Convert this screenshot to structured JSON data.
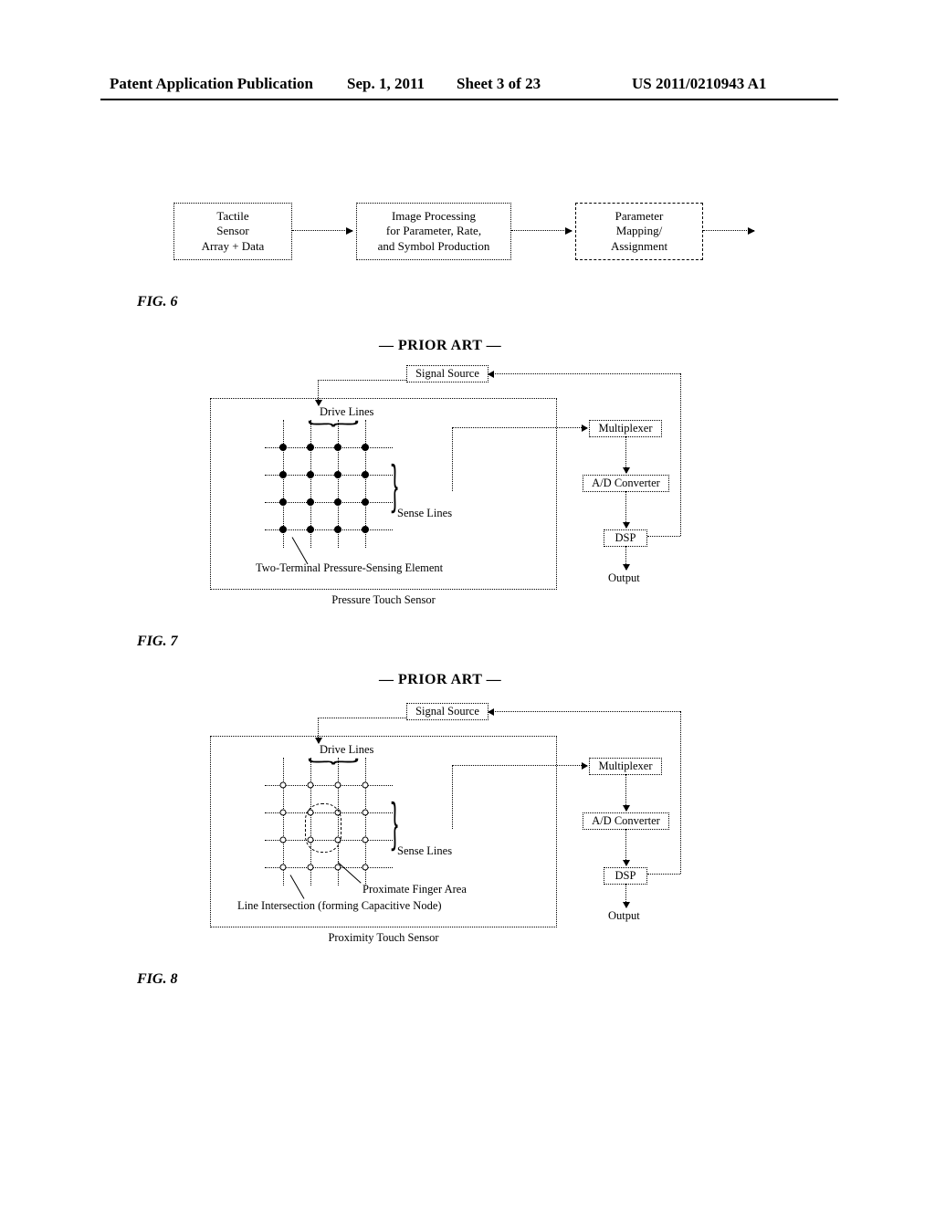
{
  "header": {
    "left": "Patent Application Publication",
    "date": "Sep. 1, 2011",
    "sheet": "Sheet 3 of 23",
    "pubno": "US 2011/0210943 A1"
  },
  "fig6": {
    "label": "FIG. 6",
    "box1": "Tactile\nSensor\nArray + Data",
    "box2": "Image Processing\nfor Parameter, Rate,\nand Symbol Production",
    "box3": "Parameter\nMapping/\nAssignment"
  },
  "priorArt": "— PRIOR ART —",
  "sensorBlocks": {
    "signal": "Signal Source",
    "mux": "Multiplexer",
    "adc": "A/D Converter",
    "dsp": "DSP",
    "output": "Output",
    "drive": "Drive Lines",
    "sense": "Sense Lines"
  },
  "fig7": {
    "label": "FIG. 7",
    "caption": "Pressure Touch Sensor",
    "element": "Two-Terminal Pressure-Sensing Element"
  },
  "fig8": {
    "label": "FIG. 8",
    "caption": "Proximity Touch Sensor",
    "finger": "Proximate Finger Area",
    "element": "Line Intersection (forming Capacitive Node)"
  },
  "chart_data": [
    {
      "type": "table",
      "title": "FIG. 6 — processing pipeline (block diagram)",
      "nodes": [
        "Tactile Sensor Array + Data",
        "Image Processing for Parameter, Rate, and Symbol Production",
        "Parameter Mapping/Assignment",
        "(out)"
      ],
      "edges": [
        [
          0,
          1
        ],
        [
          1,
          2
        ],
        [
          2,
          3
        ]
      ]
    },
    {
      "type": "table",
      "title": "FIG. 7 — Pressure Touch Sensor (PRIOR ART)",
      "nodes": [
        "Signal Source",
        "Drive Lines",
        "Sense Lines",
        "Two-Terminal Pressure-Sensing Element",
        "Multiplexer",
        "A/D Converter",
        "DSP",
        "Output"
      ],
      "edges": [
        [
          0,
          1
        ],
        [
          2,
          4
        ],
        [
          4,
          5
        ],
        [
          5,
          6
        ],
        [
          6,
          7
        ],
        [
          6,
          0
        ]
      ],
      "grid": {
        "drive_lines": 4,
        "sense_lines": 4,
        "node_type": "pressure-sensing element (filled dot)"
      }
    },
    {
      "type": "table",
      "title": "FIG. 8 — Proximity Touch Sensor (PRIOR ART)",
      "nodes": [
        "Signal Source",
        "Drive Lines",
        "Sense Lines",
        "Line Intersection (forming Capacitive Node)",
        "Proximate Finger Area",
        "Multiplexer",
        "A/D Converter",
        "DSP",
        "Output"
      ],
      "edges": [
        [
          0,
          1
        ],
        [
          2,
          5
        ],
        [
          5,
          6
        ],
        [
          6,
          7
        ],
        [
          7,
          8
        ],
        [
          7,
          0
        ]
      ],
      "grid": {
        "drive_lines": 4,
        "sense_lines": 4,
        "node_type": "capacitive node (open circle)"
      }
    }
  ]
}
